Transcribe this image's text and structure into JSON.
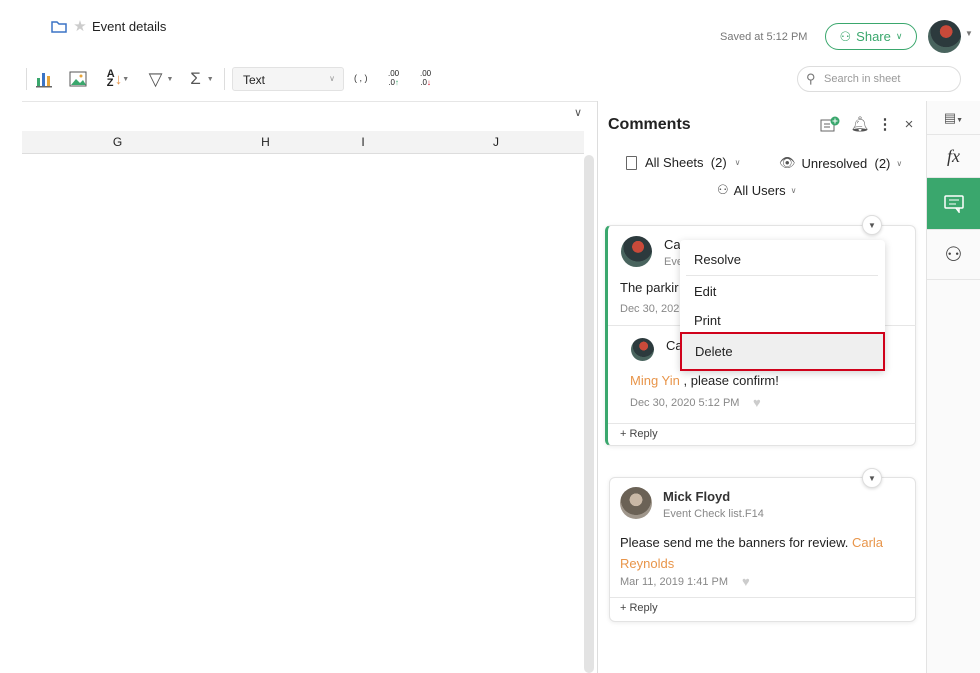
{
  "header": {
    "title": "Event details",
    "saved_status": "Saved at 5:12 PM",
    "share_label": "Share",
    "search_placeholder": "Search in sheet"
  },
  "toolbar": {
    "format_select": "Text",
    "comma_label": "( , )",
    "dec_label": ".00"
  },
  "sheet": {
    "columns": [
      "G",
      "H",
      "I",
      "J"
    ]
  },
  "comments": {
    "title": "Comments",
    "filters": {
      "sheets": "All Sheets  (2)",
      "status": "Unresolved  (2)",
      "users": "All Users"
    },
    "thread1": {
      "author_partial": "Ca",
      "ref_partial": "Eve",
      "body_partial": "The parkir",
      "date_partial": "Dec 30, 202",
      "reply": {
        "author_partial": "Ca",
        "mention": "Ming Yin",
        "text": " , please confirm!",
        "date": "Dec 30, 2020 5:12 PM"
      },
      "reply_label": "+ Reply"
    },
    "menu": {
      "items": [
        "Resolve",
        "Edit",
        "Print",
        "Delete"
      ]
    },
    "thread2": {
      "author": "Mick Floyd",
      "ref": "Event Check list.F14",
      "body": "Please send me the banners for review. ",
      "mention": "Carla Reynolds",
      "date": "Mar 11, 2019 1:41 PM",
      "reply_label": "+ Reply"
    }
  },
  "sidebar": {
    "fx_label": "fx"
  },
  "colors": {
    "accent": "#3aa76d",
    "mention": "#e8954a",
    "highlight": "#d0021b"
  }
}
